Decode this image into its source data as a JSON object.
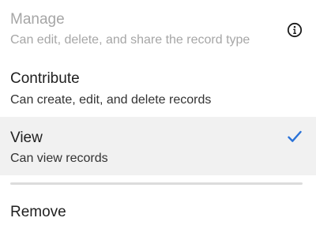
{
  "menu": {
    "options": [
      {
        "title": "Manage",
        "description": "Can edit, delete, and share the record type",
        "icon": "info-icon",
        "disabled": true
      },
      {
        "title": "Contribute",
        "description": "Can create, edit, and delete records"
      },
      {
        "title": "View",
        "description": "Can view records",
        "selected": true,
        "icon": "checkmark-icon"
      }
    ],
    "remove_label": "Remove"
  },
  "colors": {
    "checkmark": "#2a72d8",
    "selected_background": "#f1f1f1",
    "disabled_text": "#a6a6a6",
    "divider": "#dcdcdc"
  }
}
